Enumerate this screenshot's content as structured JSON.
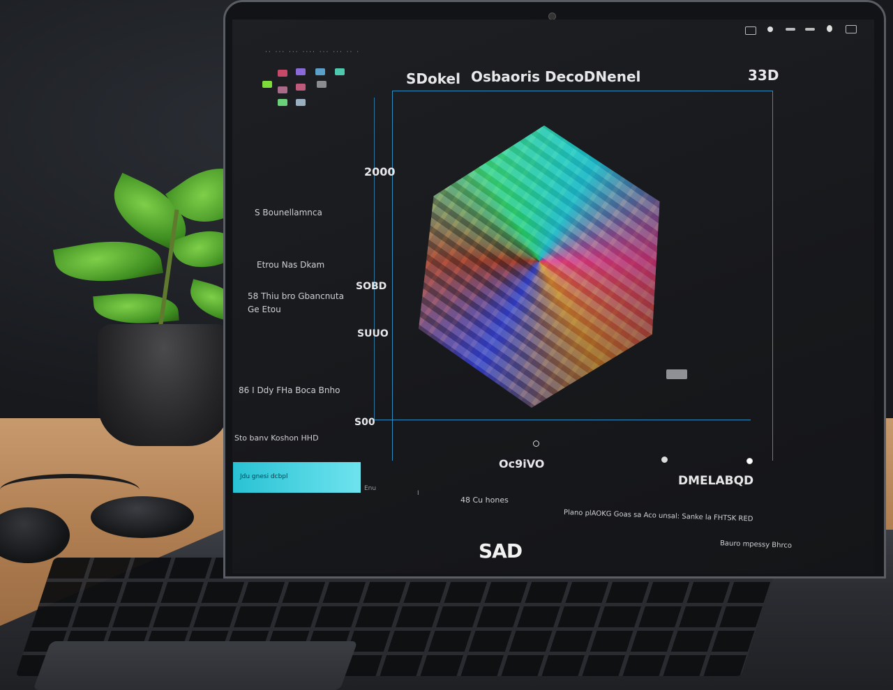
{
  "screen": {
    "brand_logo": "SAD",
    "header": {
      "left_title": "SDokel",
      "center_title": "Osbaoris DecoDNenel",
      "right_tag": "33D"
    },
    "sidebar": {
      "items": [
        {
          "label": "S Bounellamnca"
        },
        {
          "label": "Etrou Nas Dkam"
        },
        {
          "label": "58 Thiu bro Gbancnuta"
        },
        {
          "label": "Ge Etou"
        },
        {
          "label": "86 I Ddy FHa Boca Bnho"
        },
        {
          "label": "Sto banv Koshon HHD"
        }
      ]
    },
    "y_axis_labels": [
      "2000",
      "SOBD",
      "SUUO",
      "S00"
    ],
    "x_axis_labels": [
      "Oc9iVO",
      "DMELABQD"
    ],
    "footer": {
      "progress_label": "Jdu gnesi dcbpl",
      "progress_fraction": 0.72,
      "tabs": [
        "Enu",
        "I",
        "48 Cu hones"
      ],
      "status_line_1": "Plano plAOKG Goas sa Aco unsal: Sanke la FHTSK RED",
      "status_line_2": "Bauro mpessy Bhrco"
    }
  },
  "colors": {
    "accent": "#2f8ec2",
    "progress": "#29c2d4"
  }
}
